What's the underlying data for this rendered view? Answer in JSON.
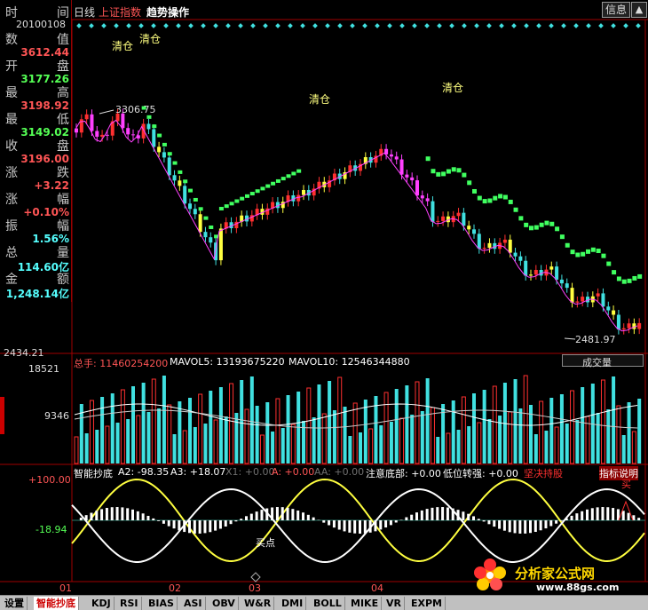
{
  "info_panel": {
    "time_label": "时",
    "interval_label": "间",
    "date": "20100108",
    "rows": [
      {
        "label": "数",
        "label2": "值",
        "value": "3612.44",
        "color": "#ff5555"
      },
      {
        "label": "开",
        "label2": "盘",
        "value": "3177.26",
        "color": "#55ff55"
      },
      {
        "label": "最",
        "label2": "高",
        "value": "3198.92",
        "color": "#ff5555"
      },
      {
        "label": "最",
        "label2": "低",
        "value": "3149.02",
        "color": "#55ff55"
      },
      {
        "label": "收",
        "label2": "盘",
        "value": "3196.00",
        "color": "#ff5555"
      },
      {
        "label": "涨",
        "label2": "跌",
        "value": "+3.22",
        "color": "#ff5555"
      },
      {
        "label": "涨",
        "label2": "幅",
        "value": "+0.10%",
        "color": "#ff5555"
      },
      {
        "label": "振",
        "label2": "幅",
        "value": "1.56%",
        "color": "#55ffff"
      },
      {
        "label": "总",
        "label2": "量",
        "value": "114.60亿",
        "color": "#55ffff"
      },
      {
        "label": "金",
        "label2": "额",
        "value": "1,248.14亿",
        "color": "#55ffff"
      }
    ]
  },
  "top_bar": {
    "period": "日线",
    "index_name": "上证指数",
    "indicator": "趋势操作",
    "info_button": "信息",
    "close_button": "▲"
  },
  "main_chart": {
    "annotations": [
      "清仓",
      "清仓",
      "清仓",
      "清仓"
    ],
    "high_label": "3306.75",
    "low_label": "2481.97",
    "right_axis_low": "2434.21"
  },
  "volume_panel": {
    "header_total": "总手: 11460254200",
    "mavol5": "MAVOL5: 13193675220",
    "mavol10": "MAVOL10: 12546344880",
    "dropdown": "成交量",
    "axis_top": "18521",
    "axis_mid": "9346"
  },
  "indicator_panel": {
    "name": "智能抄底",
    "a2": "A2: -98.35",
    "a3": "A3: +18.07",
    "x1": "X1: +0.00",
    "a": "A: +0.00",
    "aa": "AA: +0.00",
    "attention": "注意底部: +0.00",
    "low_turn": "低位转强: +0.00",
    "firm_hold": "坚决持股",
    "help": "指标说明",
    "axis_top": "+100.00",
    "axis_mid": "-18.94",
    "buy_label": "买点",
    "buy_marker": "买"
  },
  "x_axis": {
    "labels": [
      "01",
      "02",
      "03",
      "04"
    ]
  },
  "bottom_tabs": [
    "设置",
    "智能抄底",
    "KDJ",
    "RSI",
    "BIAS",
    "ASI",
    "OBV",
    "W&R",
    "DMI",
    "BOLL",
    "MIKE",
    "VR",
    "EXPM"
  ],
  "watermark": {
    "title": "分析家公式网",
    "url": "www.88gs.com"
  },
  "colors": {
    "up": "#ff3030",
    "down": "#40e0e0",
    "yellow": "#ffff40",
    "green": "#40ff60",
    "magenta": "#ff40ff",
    "axis_red": "#a00000"
  }
}
